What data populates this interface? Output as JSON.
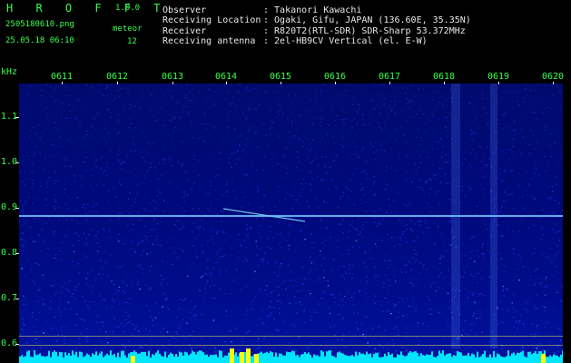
{
  "header": {
    "title": "H R O F F T",
    "version": "1.0.0",
    "filename": "2505180610.png",
    "datetime": "25.05.18 06:10",
    "meteor_label": "meteor",
    "meteor_count": "12"
  },
  "info": {
    "observer_label": "Observer",
    "observer_value": ": Takanori Kawachi",
    "location_label": "Receiving Location",
    "location_value": ": Ogaki, Gifu, JAPAN (136.60E, 35.35N)",
    "receiver_label": "Receiver",
    "receiver_value": ": R820T2(RTL-SDR) SDR-Sharp 53.372MHz",
    "antenna_label": "Receiving antenna",
    "antenna_value": ": 2el-HB9CV Vertical (el. E-W)"
  },
  "axis": {
    "y_unit": "kHz",
    "y_ticks": [
      "1.1",
      "1.0",
      "0.9",
      "0.8",
      "0.7",
      "0.6"
    ],
    "x_ticks": [
      "0611",
      "0612",
      "0613",
      "0614",
      "0615",
      "0616",
      "0617",
      "0618",
      "0619",
      "0620"
    ]
  },
  "colors": {
    "label_green": "#39ff4a",
    "text_white": "#e8e8e8",
    "signal_cyan": "#00e5ff",
    "signal_yellow": "#ffff00"
  }
}
